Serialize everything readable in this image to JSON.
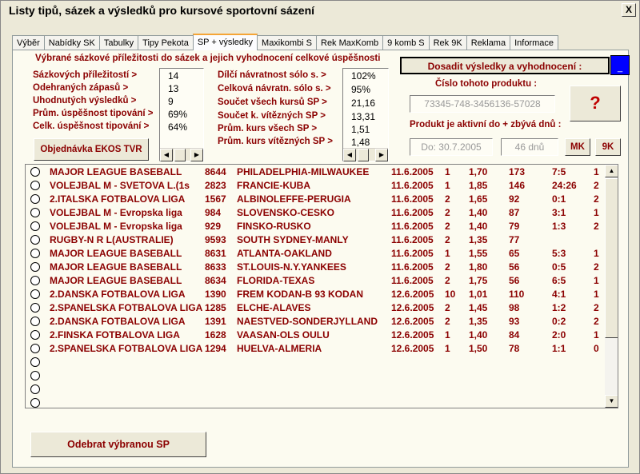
{
  "window": {
    "title": "Listy tipů, sázek a výsledků pro kursové sportovní sázení",
    "close_label": "X"
  },
  "tabs": [
    {
      "label": "Výběr"
    },
    {
      "label": "Nabídky SK"
    },
    {
      "label": "Tabulky"
    },
    {
      "label": "Tipy Pekota"
    },
    {
      "label": "SP + výsledky"
    },
    {
      "label": "Maxikombi S"
    },
    {
      "label": "Rek MaxKomb"
    },
    {
      "label": "9 komb S"
    },
    {
      "label": "Rek 9K"
    },
    {
      "label": "Reklama"
    },
    {
      "label": "Informace"
    }
  ],
  "heading": "Výbrané sázkové příležitosti do sázek a jejich vyhodnocení celkové úspěšnosti",
  "left_stats": {
    "labels": [
      "Sázkových příležitostí >",
      "Odehraných zápasů >",
      "Uhodnutých výsledků >",
      "Prům. úspěšnost tipování >",
      "Celk. úspěšnost tipování >"
    ],
    "values": [
      "14",
      "13",
      "9",
      "69%",
      "64%"
    ]
  },
  "middle_stats": {
    "labels": [
      "Dílčí návratnost sólo s. >",
      "Celková návratn. sólo s. >",
      "Součet všech kursů SP >",
      "Součet k. vítězných SP >",
      "Prům. kurs všech SP >",
      "Prům. kurs vítězných SP >"
    ],
    "values": [
      "102%",
      "95%",
      "21,16",
      "13,31",
      "1,51",
      "1,48"
    ]
  },
  "buttons": {
    "order": "Objednávka EKOS TVR",
    "evaluate": "Dosadit výsledky a vyhodnocení :",
    "evaluate_side": "_",
    "help": "?",
    "mk": "MK",
    "nine_k": "9K",
    "remove": "Odebrat výbranou SP"
  },
  "product": {
    "number_label": "Číslo tohoto produktu :",
    "number_value": "73345-748-3456136-57028",
    "active_label": "Produkt je aktivní do + zbývá dnů :",
    "active_until": "Do: 30.7.2005",
    "days_left": "46 dnů"
  },
  "rows": [
    {
      "league": "MAJOR LEAGUE BASEBALL",
      "code": "8644",
      "match": "PHILADELPHIA-MILWAUKEE",
      "date": "11.6.2005",
      "tip": "1",
      "odds": "1,70",
      "n": "173",
      "score": "7:5",
      "res": "1"
    },
    {
      "league": "VOLEJBAL M - SVETOVA L.(1s",
      "code": "2823",
      "match": "FRANCIE-KUBA",
      "date": "11.6.2005",
      "tip": "1",
      "odds": "1,85",
      "n": "146",
      "score": "24:26",
      "res": "2"
    },
    {
      "league": "2.ITALSKA FOTBALOVA LIGA",
      "code": "1567",
      "match": "ALBINOLEFFE-PERUGIA",
      "date": "11.6.2005",
      "tip": "2",
      "odds": "1,65",
      "n": "92",
      "score": "0:1",
      "res": "2"
    },
    {
      "league": "VOLEJBAL M - Evropska liga",
      "code": "984",
      "match": "SLOVENSKO-CESKO",
      "date": "11.6.2005",
      "tip": "2",
      "odds": "1,40",
      "n": "87",
      "score": "3:1",
      "res": "1"
    },
    {
      "league": "VOLEJBAL M - Evropska liga",
      "code": "929",
      "match": "FINSKO-RUSKO",
      "date": "11.6.2005",
      "tip": "2",
      "odds": "1,40",
      "n": "79",
      "score": "1:3",
      "res": "2"
    },
    {
      "league": "RUGBY-N R L(AUSTRALIE)",
      "code": "9593",
      "match": "SOUTH SYDNEY-MANLY",
      "date": "11.6.2005",
      "tip": "2",
      "odds": "1,35",
      "n": "77",
      "score": "",
      "res": ""
    },
    {
      "league": "MAJOR LEAGUE BASEBALL",
      "code": "8631",
      "match": "ATLANTA-OAKLAND",
      "date": "11.6.2005",
      "tip": "1",
      "odds": "1,55",
      "n": "65",
      "score": "5:3",
      "res": "1"
    },
    {
      "league": "MAJOR LEAGUE BASEBALL",
      "code": "8633",
      "match": "ST.LOUIS-N.Y.YANKEES",
      "date": "11.6.2005",
      "tip": "2",
      "odds": "1,80",
      "n": "56",
      "score": "0:5",
      "res": "2"
    },
    {
      "league": "MAJOR LEAGUE BASEBALL",
      "code": "8634",
      "match": "FLORIDA-TEXAS",
      "date": "11.6.2005",
      "tip": "2",
      "odds": "1,75",
      "n": "56",
      "score": "6:5",
      "res": "1"
    },
    {
      "league": "2.DANSKA FOTBALOVA LIGA",
      "code": "1390",
      "match": "FREM KODAN-B 93 KODAN",
      "date": "12.6.2005",
      "tip": "10",
      "odds": "1,01",
      "n": "110",
      "score": "4:1",
      "res": "1"
    },
    {
      "league": "2.SPANELSKA FOTBALOVA LIGA",
      "code": "1285",
      "match": "ELCHE-ALAVES",
      "date": "12.6.2005",
      "tip": "2",
      "odds": "1,45",
      "n": "98",
      "score": "1:2",
      "res": "2"
    },
    {
      "league": "2.DANSKA FOTBALOVA LIGA",
      "code": "1391",
      "match": "NAESTVED-SONDERJYLLAND",
      "date": "12.6.2005",
      "tip": "2",
      "odds": "1,35",
      "n": "93",
      "score": "0:2",
      "res": "2"
    },
    {
      "league": "2.FINSKA FOTBALOVA LIGA",
      "code": "1628",
      "match": "VAASAN-OLS OULU",
      "date": "12.6.2005",
      "tip": "1",
      "odds": "1,40",
      "n": "84",
      "score": "2:0",
      "res": "1"
    },
    {
      "league": "2.SPANELSKA FOTBALOVA LIGA",
      "code": "1294",
      "match": "HUELVA-ALMERIA",
      "date": "12.6.2005",
      "tip": "1",
      "odds": "1,50",
      "n": "78",
      "score": "1:1",
      "res": "0"
    }
  ],
  "empty_rows": 5,
  "colors": {
    "accent": "#8b0000",
    "background": "#fcfbf0",
    "blue": "#0000ff"
  }
}
